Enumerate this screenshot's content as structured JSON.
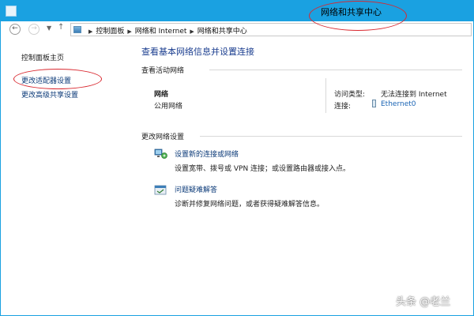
{
  "window": {
    "title": "网络和共享中心"
  },
  "address_bar": {
    "crumbs": [
      "控制面板",
      "网络和 Internet",
      "网络和共享中心"
    ]
  },
  "left_pane": {
    "home": "控制面板主页",
    "change_adapter": "更改适配器设置",
    "change_advanced_sharing": "更改高级共享设置"
  },
  "main": {
    "title": "查看基本网络信息并设置连接",
    "active_networks": {
      "heading": "查看活动网络",
      "network_name": "网络",
      "network_type": "公用网络",
      "access_type_label": "访问类型:",
      "access_type_value": "无法连接到 Internet",
      "connections_label": "连接:",
      "connections_value": "Ethernet0"
    },
    "change_settings": {
      "heading": "更改网络设置",
      "tasks": [
        {
          "title": "设置新的连接或网络",
          "desc": "设置宽带、拨号或 VPN 连接；或设置路由器或接入点。",
          "icon": "network-setup-icon"
        },
        {
          "title": "问题疑难解答",
          "desc": "诊断并修复网络问题，或者获得疑难解答信息。",
          "icon": "troubleshoot-icon"
        }
      ]
    }
  },
  "watermark": "头条 @老兰",
  "colors": {
    "titlebar": "#1aa1e1",
    "link": "#0b3a78",
    "heading": "#1a3d8f",
    "annotation": "#d9282f"
  }
}
